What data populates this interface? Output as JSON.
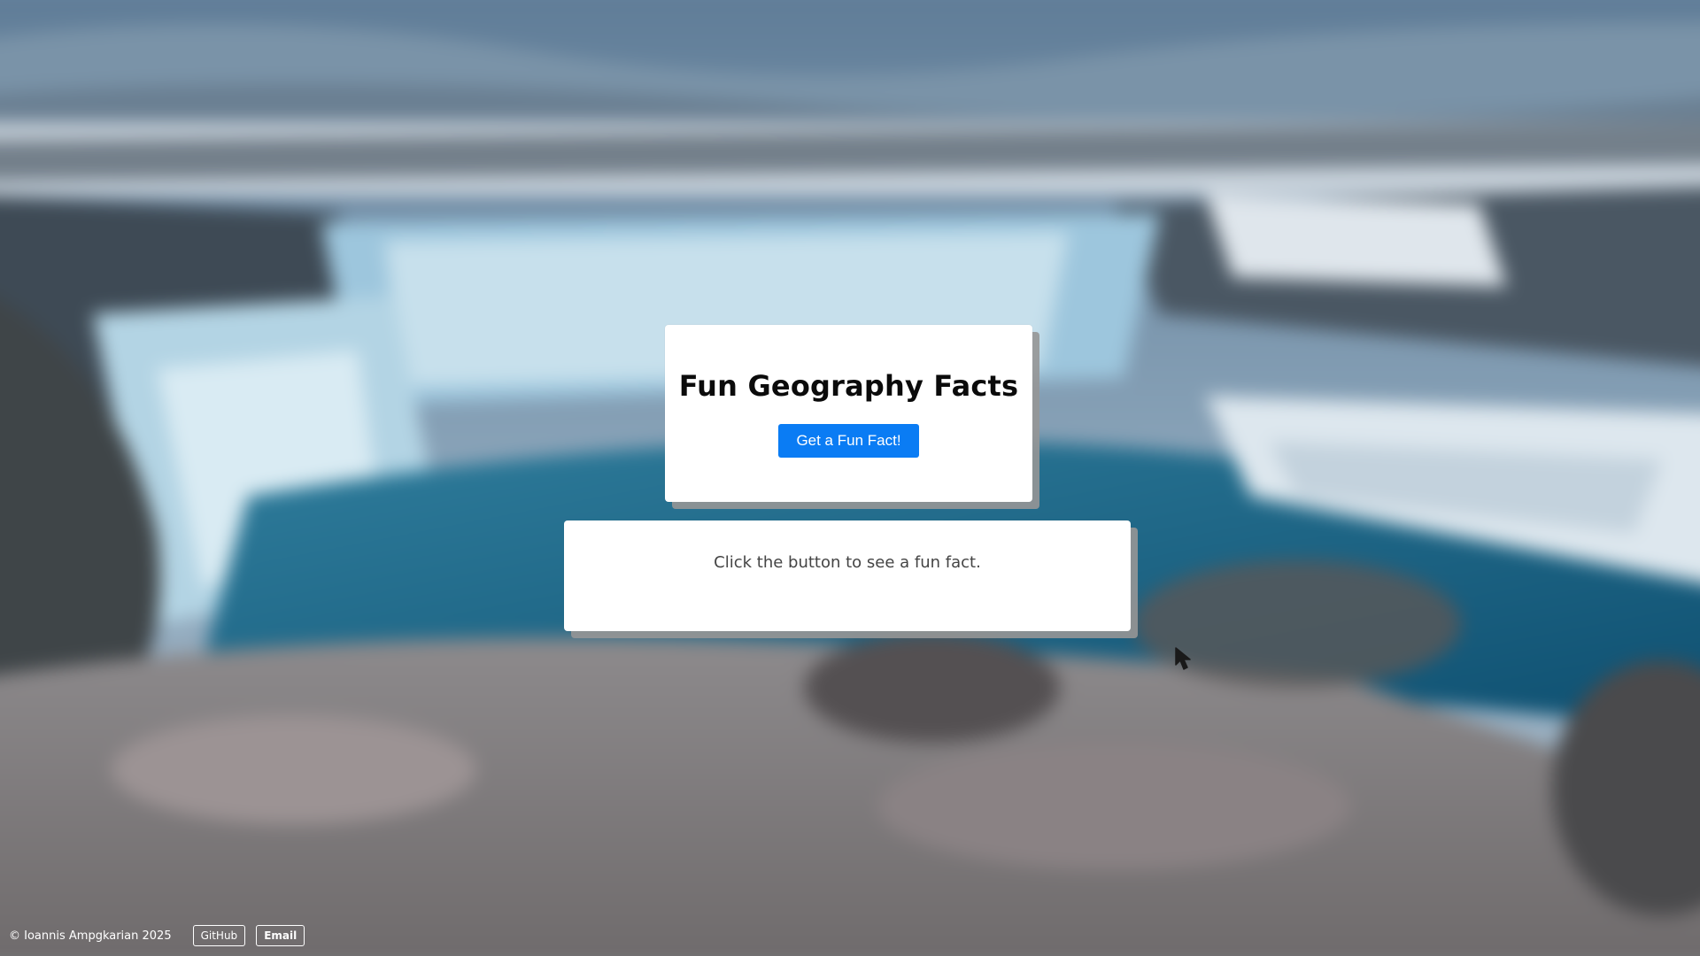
{
  "card": {
    "title": "Fun Geography Facts",
    "button_label": "Get a Fun Fact!"
  },
  "fact": {
    "text": "Click the button to see a fun fact."
  },
  "footer": {
    "copyright": "© Ioannis Ampgkarian 2025",
    "github_label": "GitHub",
    "email_label": "Email"
  },
  "colors": {
    "button": "#0a7cf4",
    "card": "#ffffff"
  },
  "background": {
    "icon": "blurred-waterfall-photo"
  }
}
